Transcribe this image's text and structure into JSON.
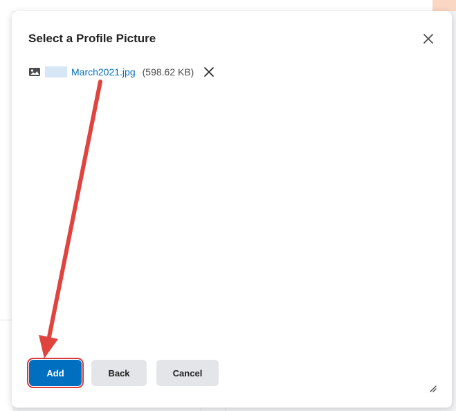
{
  "dialog": {
    "title": "Select a Profile Picture",
    "close_icon": "close-icon"
  },
  "file": {
    "name": "March2021.jpg",
    "size": "(598.62 KB)",
    "icon": "image-icon",
    "remove_icon": "remove-file-icon"
  },
  "buttons": {
    "add": "Add",
    "back": "Back",
    "cancel": "Cancel"
  },
  "annotation": {
    "arrow_color": "#e0443e",
    "highlight_color": "#d93a3a"
  },
  "colors": {
    "primary": "#006fbf",
    "link": "#006fbf",
    "secondary_button": "#e3e5e8"
  }
}
